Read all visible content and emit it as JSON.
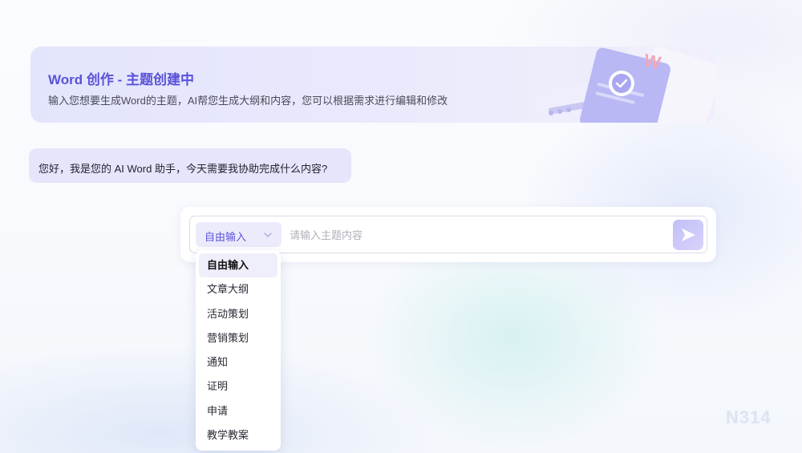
{
  "banner": {
    "title": "Word 创作 - 主题创建中",
    "subtitle": "输入您想要生成Word的主题，AI帮您生成大纲和内容，您可以根据需求进行编辑和修改",
    "illustration_letter": "W"
  },
  "chat": {
    "greeting": "您好，我是您的 AI Word 助手，今天需要我协助完成什么内容?"
  },
  "composer": {
    "mode_selected": "自由输入",
    "input_value": "",
    "input_placeholder": "请输入主题内容",
    "send_icon": "send-icon"
  },
  "dropdown": {
    "options": [
      "自由输入",
      "文章大纲",
      "活动策划",
      "营销策划",
      "通知",
      "证明",
      "申请",
      "教学教案"
    ],
    "selected": "自由输入"
  },
  "watermark": "N314",
  "colors": {
    "accent": "#5a52d8",
    "banner_bg": "#e6e7fc",
    "bubble_bg": "#e6e5fb",
    "send_bg": "#c8c5f9"
  }
}
